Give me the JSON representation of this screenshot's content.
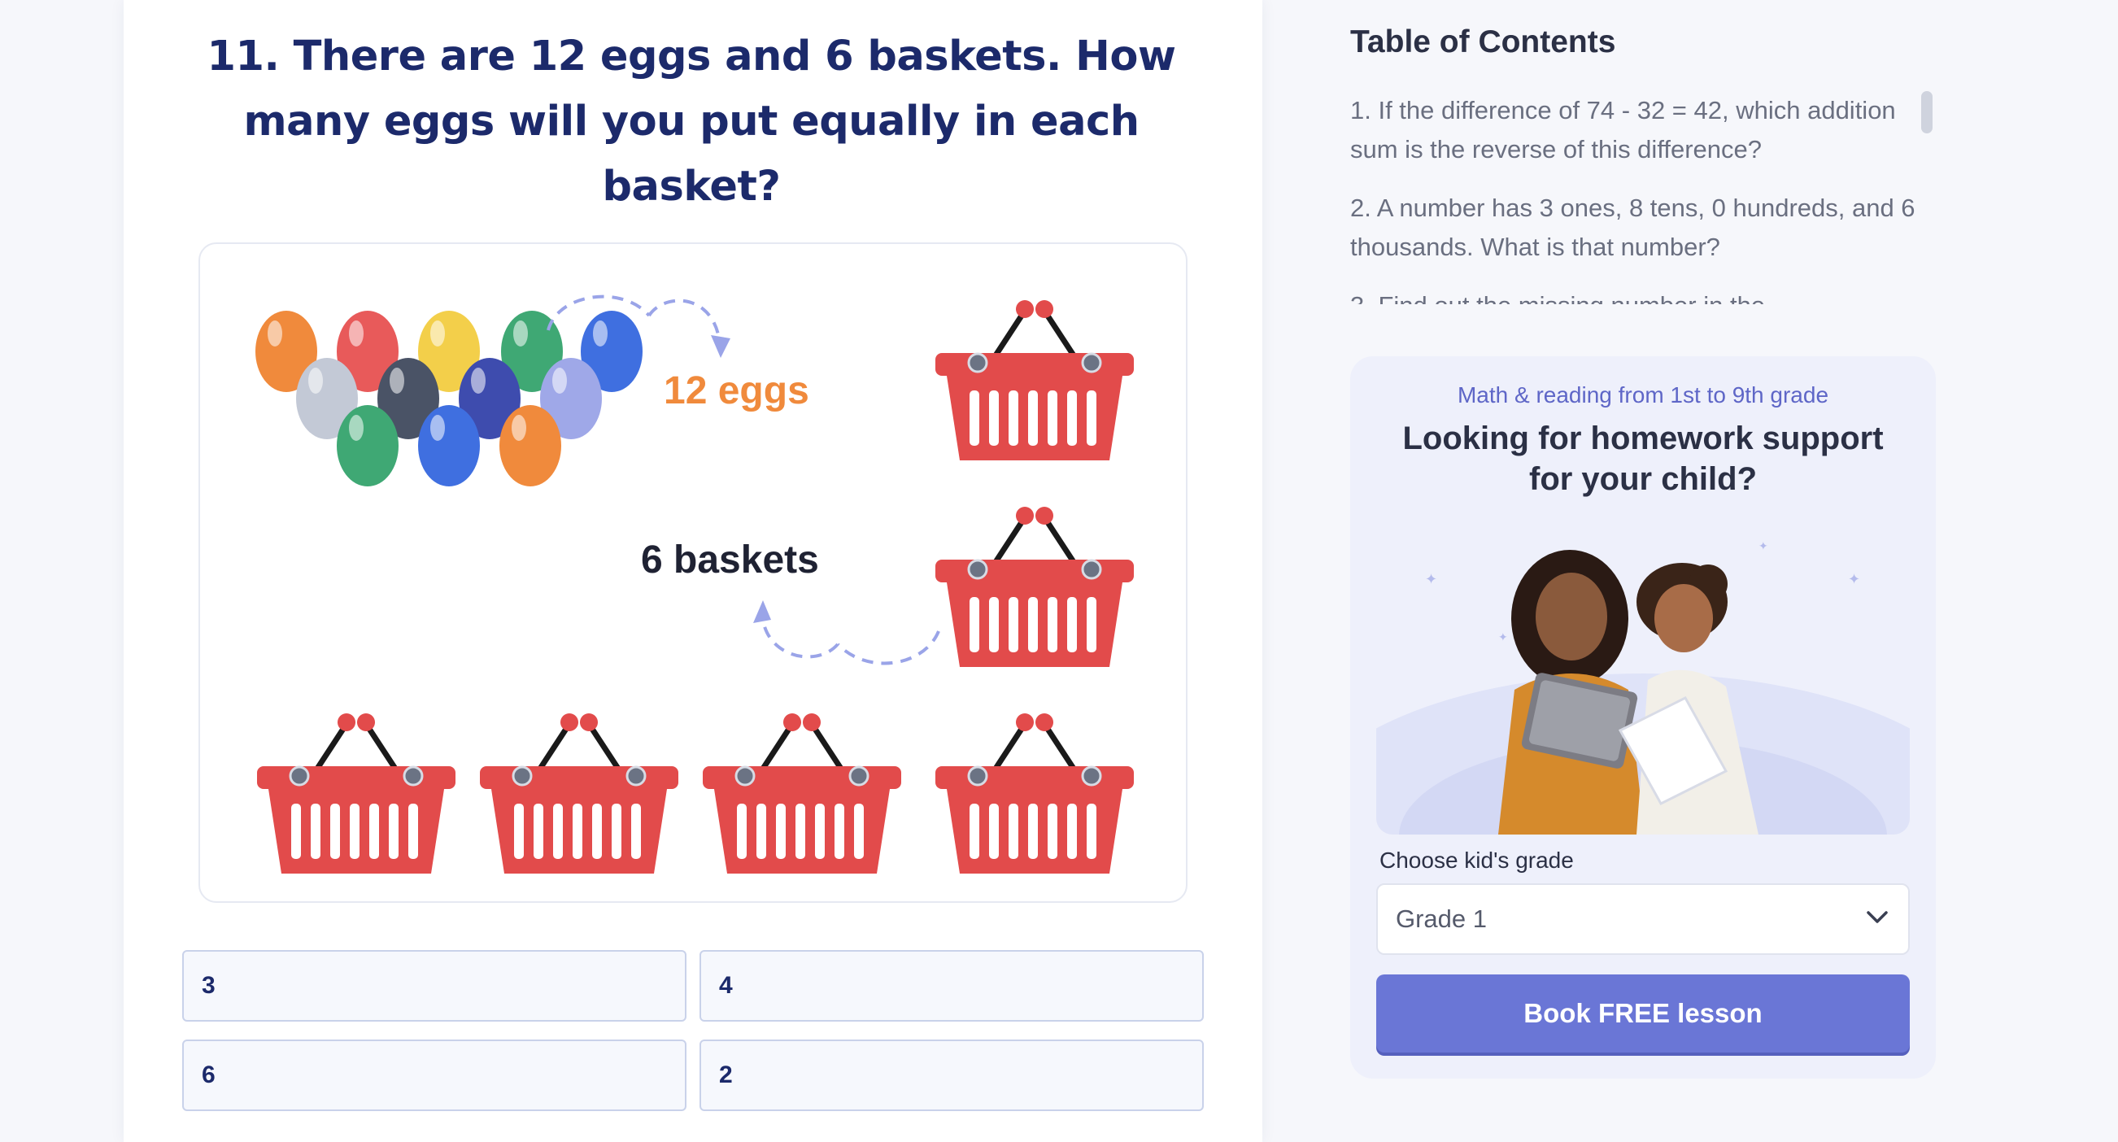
{
  "question": {
    "title": "11. There are 12 eggs and 6 baskets. How many eggs will you put equally in each basket?",
    "illustration": {
      "eggs_label": "12 eggs",
      "baskets_label": "6 baskets",
      "egg_colors": [
        "#f08a3c",
        "#e85a5a",
        "#f3cf4a",
        "#3fa874",
        "#3f6fe0",
        "#c3c9d6",
        "#4a5366",
        "#3e4cae",
        "#9fa8e8",
        "#3fa874",
        "#3f6fe0",
        "#f08a3c"
      ],
      "basket_color": "#e24b4b",
      "accent_orange": "#f08a3c",
      "arrow_color": "#9aa4e8"
    },
    "answers": [
      "3",
      "4",
      "6",
      "2"
    ]
  },
  "sidebar": {
    "toc_title": "Table of Contents",
    "toc_items": [
      "1. If the difference of 74 - 32 = 42, which addition sum is the reverse of this difference?",
      "2. A number has 3 ones, 8 tens, 0 hundreds, and 6 thousands. What is that number?",
      "3. Find out the missing number in the"
    ],
    "promo": {
      "subtitle": "Math & reading from 1st to 9th grade",
      "title": "Looking for homework support for your child?",
      "grade_label": "Choose kid's grade",
      "grade_value": "Grade 1",
      "cta": "Book FREE lesson"
    }
  },
  "colors": {
    "title": "#1c2a6b",
    "accent": "#6a76d6",
    "page_bg": "#f6f7fb"
  }
}
